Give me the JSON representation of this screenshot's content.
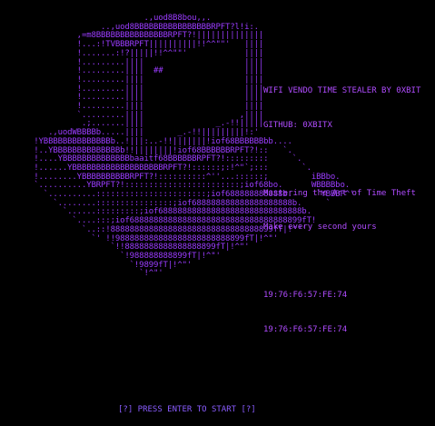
{
  "banner": {
    "ascii_lines": [
      "                        .,uod8B8bou,,.",
      "               ..,uod8BBBBBBBBBBBBBBBBRPFT?l!i:.",
      "          ,=m8BBBBBBBBBBBBBBBRPFT?!||||||||||||||",
      "          !...:!TVBBBRPFT||||||||||!!^^\"\"'   ||||",
      "          !.......:!?|||||!!^^\"\"'            ||||",
      "          !.........||||                     ||||",
      "          !.........||||  ##                 ||||",
      "          !.........||||                     ||||",
      "          !.........||||                     ||||",
      "          !.........||||                     ||||",
      "          !.........||||                     ||||",
      "          `.........||||                    ,||||",
      "           .;.......||||               _.-!!|||||",
      "    .,uodWBBBBb.....||||       _.-!!|||||||||!:'",
      " !YBBBBBBBBBBBBBBb..!|||:..-!!|||||||!iof68BBBBBBbb....",
      " !..YBBBBBBBBBBBBBBb!!||||||||!iof68BBBBBBRPFT?!::   `.",
      " !....YBBBBBBBBBBBBBBbaaitf68BBBBBBRPFT?!:::::::::     `.",
      " !......YBBBBBBBBBBBBBBBBBBBRPFT?!::::::;:!^\"`;:::       `.",
      " !........YBBBBBBBBBBRPFT?!::::::::::^''...::::::;         iBBbo.",
      " `..........YBRPFT?!::::::::::::::::::::::::;iof68bo.      WBBBBbo.",
      "   `..........:::::::::::::::::::::::;iof688888888888b.     `YBBBP^'",
      "     `........::::::::::::::::;iof688888888888888888888b.     `",
      "       `......:::::::::;iof688888888888888888888888888888b.",
      "         `....:::;iof688888888888888888888888888888888899fT!",
      "           `..::!8888888888888888888888888888888899fT|!^\"'",
      "             `' !!988888888888888888888888899fT|!^\"'",
      "                 `!!8888888888888888899fT|!^\"'",
      "                   `!988888888899fT|!^\"'",
      "                     `!9899fT|!^\"'",
      "                       `!^\"'"
    ]
  },
  "info": {
    "title": "WIFI VENDO TIME STEALER BY 0XBIT",
    "github": "GITHUB: 0XBITX",
    "tagline": "Mastering the Art of Time Theft",
    "subtitle": "Make every second yours",
    "mac_1": "19:76:F6:57:FE:74",
    "mac_2": "19:76:F6:57:FE:74"
  },
  "prompt": {
    "text": "[?] PRESS ENTER TO START [?]"
  },
  "colors": {
    "background": "#000000",
    "art": "#9b3cff",
    "info_text": "#b04cff",
    "prompt": "#8a5cff"
  }
}
